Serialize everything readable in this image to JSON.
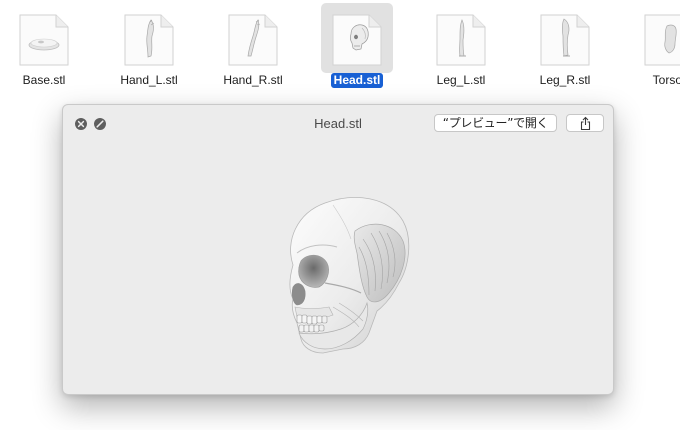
{
  "files": [
    {
      "name": "Base.stl",
      "icon": "base-model-icon",
      "selected": false
    },
    {
      "name": "Hand_L.stl",
      "icon": "hand-model-icon",
      "selected": false
    },
    {
      "name": "Hand_R.stl",
      "icon": "hand-model-icon",
      "selected": false
    },
    {
      "name": "Head.stl",
      "icon": "skull-model-icon",
      "selected": true
    },
    {
      "name": "Leg_L.stl",
      "icon": "leg-model-icon",
      "selected": false
    },
    {
      "name": "Leg_R.stl",
      "icon": "leg-model-icon",
      "selected": false
    },
    {
      "name": "Torso.",
      "icon": "torso-model-icon",
      "selected": false
    }
  ],
  "quicklook": {
    "title": "Head.stl",
    "open_with_label": "“プレビュー”で開く",
    "close_icon": "close-icon",
    "fullscreen_icon": "fullscreen-icon",
    "share_icon": "share-icon",
    "preview_icon": "skull-3d-preview"
  },
  "colors": {
    "selection": "#1860d4",
    "window_background": "#ececec"
  }
}
